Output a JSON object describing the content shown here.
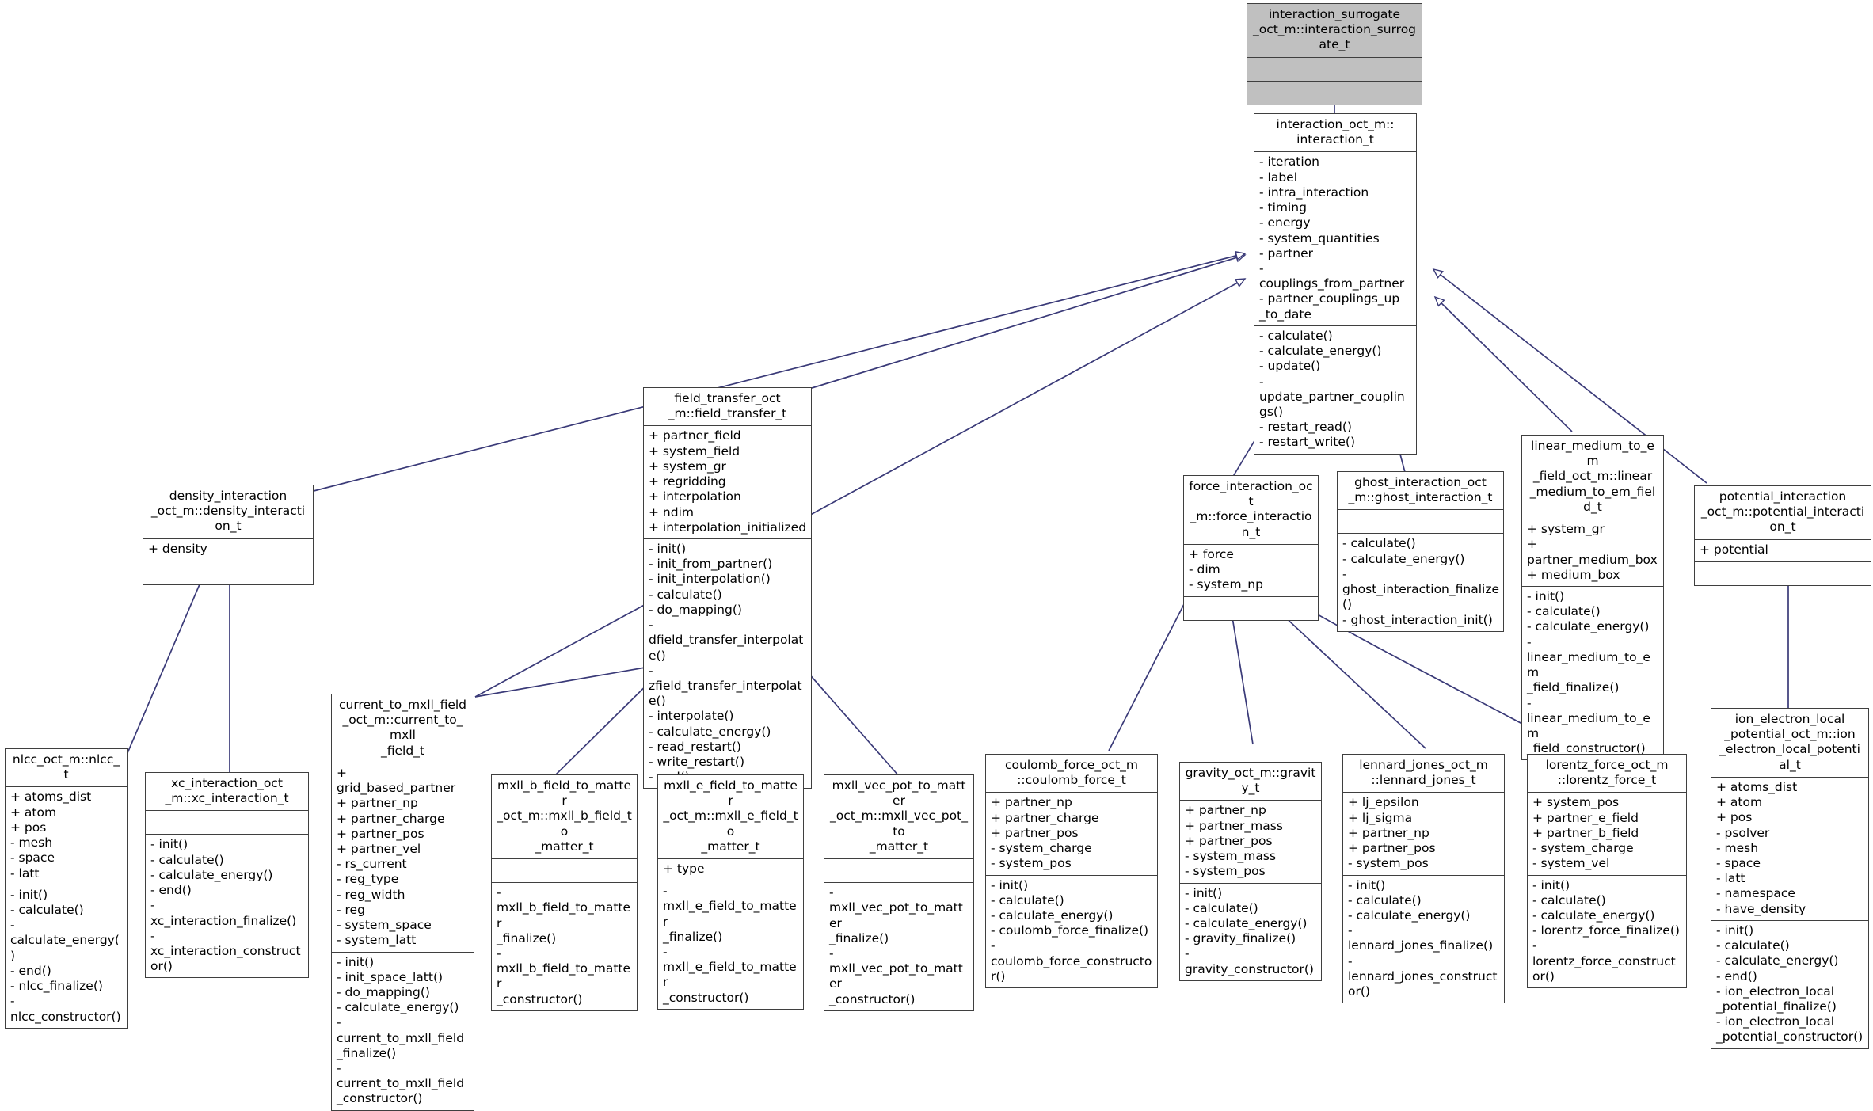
{
  "diagram": {
    "kind": "uml-class-inheritance-diagram",
    "background": "#ffffff",
    "edge_color": "#3a3a78",
    "root_fill": "#c0c0c0",
    "node_fill": "#ffffff",
    "border_color": "#3f3f3f"
  },
  "nodes": {
    "interaction_surrogate": {
      "title": "interaction_surrogate\n_oct_m::interaction_surrogate_t",
      "attrs": [],
      "ops": []
    },
    "interaction": {
      "title": "interaction_oct_m::\n     interaction_t",
      "attrs": [
        "- iteration",
        "- label",
        "- intra_interaction",
        "- timing",
        "- energy",
        "- system_quantities",
        "- partner",
        "- couplings_from_partner",
        "- partner_couplings_up\n_to_date"
      ],
      "ops": [
        "- calculate()",
        "- calculate_energy()",
        "- update()",
        "- update_partner_couplings()",
        "- restart_read()",
        "- restart_write()"
      ]
    },
    "field_transfer": {
      "title": "field_transfer_oct\n     _m::field_transfer_t",
      "attrs": [
        "+ partner_field",
        "+ system_field",
        "+ system_gr",
        "+ regridding",
        "+ interpolation",
        "+ ndim",
        "+ interpolation_initialized"
      ],
      "ops": [
        "- init()",
        "- init_from_partner()",
        "- init_interpolation()",
        "- calculate()",
        "- do_mapping()",
        "- dfield_transfer_interpolate()",
        "- zfield_transfer_interpolate()",
        "- interpolate()",
        "- calculate_energy()",
        "- read_restart()",
        "- write_restart()",
        "- end()"
      ]
    },
    "density_interaction": {
      "title": "density_interaction\n_oct_m::density_interaction_t",
      "attrs": [
        "+ density"
      ],
      "ops": []
    },
    "force_interaction": {
      "title": "force_interaction_oct\n_m::force_interaction_t",
      "attrs": [
        "+ force",
        "- dim",
        "- system_np"
      ],
      "ops": []
    },
    "ghost_interaction": {
      "title": "ghost_interaction_oct\n   _m::ghost_interaction_t",
      "attrs": [],
      "ops": [
        "- calculate()",
        "- calculate_energy()",
        "- ghost_interaction_finalize()",
        "- ghost_interaction_init()"
      ]
    },
    "linear_medium_to_em_field": {
      "title": "linear_medium_to_em\n_field_oct_m::linear\n_medium_to_em_field_t",
      "attrs": [
        "+ system_gr",
        "+ partner_medium_box",
        "+ medium_box"
      ],
      "ops": [
        "- init()",
        "- calculate()",
        "- calculate_energy()",
        "- linear_medium_to_em\n_field_finalize()",
        "- linear_medium_to_em\n_field_constructor()"
      ]
    },
    "potential_interaction": {
      "title": "potential_interaction\n_oct_m::potential_interaction_t",
      "attrs": [
        "+ potential"
      ],
      "ops": []
    },
    "nlcc": {
      "title": "nlcc_oct_m::nlcc_t",
      "attrs": [
        "+ atoms_dist",
        "+ atom",
        "+ pos",
        "- mesh",
        "- space",
        "- latt"
      ],
      "ops": [
        "- init()",
        "- calculate()",
        "- calculate_energy()",
        "- end()",
        "- nlcc_finalize()",
        "- nlcc_constructor()"
      ]
    },
    "xc_interaction": {
      "title": "xc_interaction_oct\n    _m::xc_interaction_t",
      "attrs": [],
      "ops": [
        "- init()",
        "- calculate()",
        "- calculate_energy()",
        "- end()",
        "- xc_interaction_finalize()",
        "- xc_interaction_constructor()"
      ]
    },
    "current_to_mxll_field": {
      "title": "current_to_mxll_field\n_oct_m::current_to_mxll\n         _field_t",
      "attrs": [
        "+ grid_based_partner",
        "+ partner_np",
        "+ partner_charge",
        "+ partner_pos",
        "+ partner_vel",
        "- rs_current",
        "- reg_type",
        "- reg_width",
        "- reg",
        "- system_space",
        "- system_latt"
      ],
      "ops": [
        "- init()",
        "- init_space_latt()",
        "- do_mapping()",
        "- calculate_energy()",
        "- current_to_mxll_field\n_finalize()",
        "- current_to_mxll_field\n_constructor()"
      ]
    },
    "mxll_b_field_to_matter": {
      "title": "mxll_b_field_to_matter\n_oct_m::mxll_b_field_to\n       _matter_t",
      "attrs": [],
      "ops": [
        "- mxll_b_field_to_matter\n_finalize()",
        "- mxll_b_field_to_matter\n_constructor()"
      ]
    },
    "mxll_e_field_to_matter": {
      "title": "mxll_e_field_to_matter\n_oct_m::mxll_e_field_to\n       _matter_t",
      "attrs": [
        "+ type"
      ],
      "ops": [
        "- mxll_e_field_to_matter\n_finalize()",
        "- mxll_e_field_to_matter\n_constructor()"
      ]
    },
    "mxll_vec_pot_to_matter": {
      "title": "mxll_vec_pot_to_matter\n_oct_m::mxll_vec_pot_to\n       _matter_t",
      "attrs": [],
      "ops": [
        "- mxll_vec_pot_to_matter\n_finalize()",
        "- mxll_vec_pot_to_matter\n_constructor()"
      ]
    },
    "coulomb_force": {
      "title": "coulomb_force_oct_m\n      ::coulomb_force_t",
      "attrs": [
        "+ partner_np",
        "+ partner_charge",
        "+ partner_pos",
        "- system_charge",
        "- system_pos"
      ],
      "ops": [
        "- init()",
        "- calculate()",
        "- calculate_energy()",
        "- coulomb_force_finalize()",
        "- coulomb_force_constructor()"
      ]
    },
    "gravity": {
      "title": "gravity_oct_m::gravity_t",
      "attrs": [
        "+ partner_np",
        "+ partner_mass",
        "+ partner_pos",
        "- system_mass",
        "- system_pos"
      ],
      "ops": [
        "- init()",
        "- calculate()",
        "- calculate_energy()",
        "- gravity_finalize()",
        "- gravity_constructor()"
      ]
    },
    "lennard_jones": {
      "title": "lennard_jones_oct_m\n      ::lennard_jones_t",
      "attrs": [
        "+ lj_epsilon",
        "+ lj_sigma",
        "+ partner_np",
        "+ partner_pos",
        "- system_pos"
      ],
      "ops": [
        "- init()",
        "- calculate()",
        "- calculate_energy()",
        "- lennard_jones_finalize()",
        "- lennard_jones_constructor()"
      ]
    },
    "lorentz_force": {
      "title": "lorentz_force_oct_m\n      ::lorentz_force_t",
      "attrs": [
        "+ system_pos",
        "+ partner_e_field",
        "+ partner_b_field",
        "- system_charge",
        "- system_vel"
      ],
      "ops": [
        "- init()",
        "- calculate()",
        "- calculate_energy()",
        "- lorentz_force_finalize()",
        "- lorentz_force_constructor()"
      ]
    },
    "ion_electron_local_potential": {
      "title": "ion_electron_local\n_potential_oct_m::ion\n_electron_local_potential_t",
      "attrs": [
        "+ atoms_dist",
        "+ atom",
        "+ pos",
        "- psolver",
        "- mesh",
        "- space",
        "- latt",
        "- namespace",
        "- have_density"
      ],
      "ops": [
        "- init()",
        "- calculate()",
        "- calculate_energy()",
        "- end()",
        "- ion_electron_local\n_potential_finalize()",
        "- ion_electron_local\n_potential_constructor()"
      ]
    }
  }
}
